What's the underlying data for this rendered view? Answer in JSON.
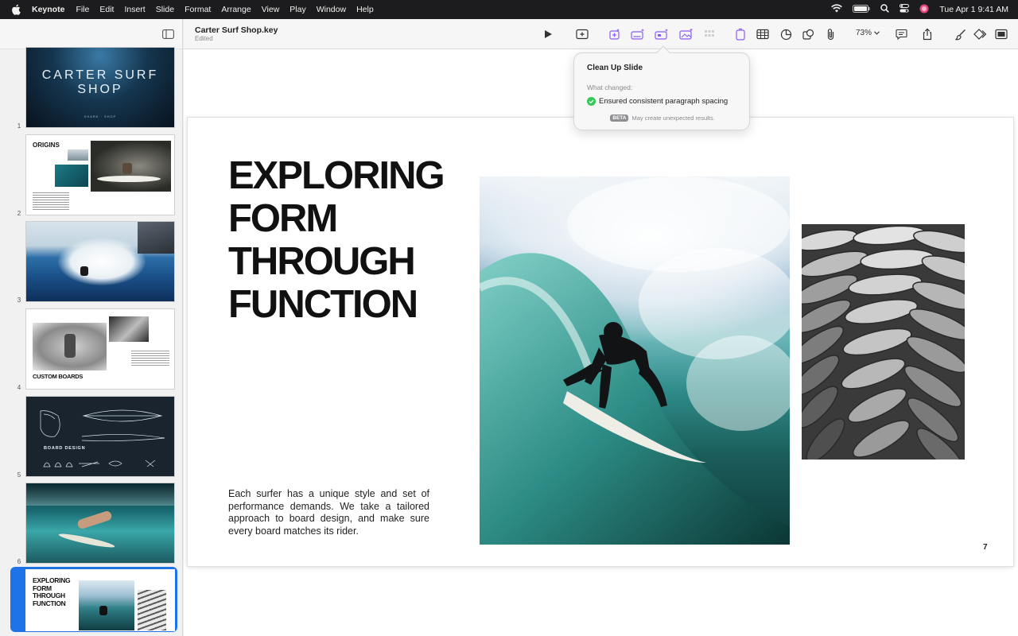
{
  "menubar": {
    "app_name": "Keynote",
    "items": [
      "File",
      "Edit",
      "Insert",
      "Slide",
      "Format",
      "Arrange",
      "View",
      "Play",
      "Window",
      "Help"
    ],
    "clock": "Tue Apr 1  9:41 AM"
  },
  "document": {
    "title": "Carter Surf Shop.key",
    "status": "Edited"
  },
  "toolbar": {
    "zoom": "73%"
  },
  "sidebar": {
    "slides": [
      {
        "number": "1",
        "title": "CARTER SURF SHOP",
        "caption": "SHARE · SHOP"
      },
      {
        "number": "2",
        "title": "ORIGINS"
      },
      {
        "number": "3"
      },
      {
        "number": "4",
        "title": "CUSTOM BOARDS"
      },
      {
        "number": "5",
        "title": "BOARD DESIGN"
      },
      {
        "number": "6"
      },
      {
        "number": "7",
        "title": "EXPLORING FORM THROUGH FUNCTION",
        "selected": true
      }
    ],
    "thumb7_lines": [
      "EXPLORING",
      "FORM",
      "THROUGH",
      "FUNCTION"
    ]
  },
  "slide": {
    "title_lines": [
      "EXPLORING",
      "FORM",
      "THROUGH",
      "FUNCTION"
    ],
    "body": "Each surfer has a unique style and set of performance demands. We take a tailored approach to board design, and make sure every board matches its rider.",
    "page_number": "7"
  },
  "popover": {
    "title": "Clean Up Slide",
    "subtitle": "What changed:",
    "item": "Ensured consistent paragraph spacing",
    "badge": "BETA",
    "footnote": "May create unexpected results."
  },
  "colors": {
    "accent": "#1e73e8",
    "purple_icons": "#8a5cf6",
    "success": "#34c759",
    "menubar": "#1c1c1e"
  }
}
